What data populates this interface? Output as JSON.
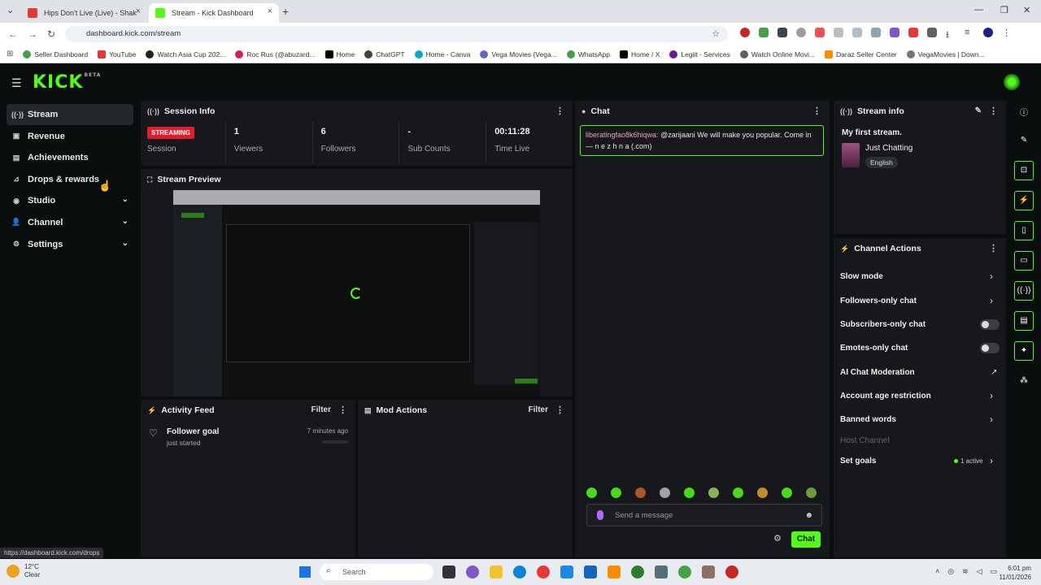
{
  "browser": {
    "tabs": [
      {
        "title": "Hips Don't Live (Live) - Shak",
        "active": false
      },
      {
        "title": "Stream - Kick Dashboard",
        "active": true
      }
    ],
    "url": "dashboard.kick.com/stream",
    "bookmarks": [
      "Seller Dashboard",
      "YouTube",
      "Watch Asia Cup 202...",
      "Roc Rus (@abuzard...",
      "Home",
      "ChatGPT",
      "Home - Canva",
      "Vega Movies (Vega...",
      "WhatsApp",
      "Home / X",
      "Legiit - Services",
      "Watch Online Movi...",
      "Daraz Seller Center",
      "VegaMovies | Down..."
    ],
    "status_url": "https://dashboard.kick.com/drops"
  },
  "app": {
    "logo": "KICK",
    "logo_tag": "BETA"
  },
  "sidebar": {
    "items": [
      {
        "label": "Stream",
        "icon": "broadcast-icon",
        "active": true,
        "chevron": false
      },
      {
        "label": "Revenue",
        "icon": "revenue-icon",
        "active": false,
        "chevron": false
      },
      {
        "label": "Achievements",
        "icon": "achievements-icon",
        "active": false,
        "chevron": false
      },
      {
        "label": "Drops & rewards",
        "icon": "drops-icon",
        "active": false,
        "chevron": false
      },
      {
        "label": "Studio",
        "icon": "studio-icon",
        "active": false,
        "chevron": true
      },
      {
        "label": "Channel",
        "icon": "channel-icon",
        "active": false,
        "chevron": true
      },
      {
        "label": "Settings",
        "icon": "settings-icon",
        "active": false,
        "chevron": true
      }
    ]
  },
  "session": {
    "title": "Session Info",
    "status_badge": "STREAMING",
    "status_label": "Session",
    "viewers_value": "1",
    "viewers_label": "Viewers",
    "followers_value": "6",
    "followers_label": "Followers",
    "subs_value": "-",
    "subs_label": "Sub Counts",
    "time_value": "00:11:28",
    "time_label": "Time Live"
  },
  "preview": {
    "title": "Stream Preview"
  },
  "activity": {
    "title": "Activity Feed",
    "filter": "Filter",
    "item_title": "Follower goal",
    "item_sub": "just started",
    "item_time": "7 minutes ago"
  },
  "mod": {
    "title": "Mod Actions",
    "filter": "Filter"
  },
  "chat": {
    "title": "Chat",
    "message_user": "liberatingfao8k6hiqwa:",
    "message_text": "@zarijaani We will make you popular. Come in — n e z h n a (.com)",
    "placeholder": "Send a message",
    "send_label": "Chat"
  },
  "stream_info": {
    "title": "Stream info",
    "stream_title": "My first stream.",
    "category": "Just Chatting",
    "language": "English"
  },
  "channel_actions": {
    "title": "Channel Actions",
    "items": [
      {
        "label": "Slow mode",
        "control": "chevron"
      },
      {
        "label": "Followers-only chat",
        "control": "chevron"
      },
      {
        "label": "Subscribers-only chat",
        "control": "toggle"
      },
      {
        "label": "Emotes-only chat",
        "control": "toggle"
      },
      {
        "label": "AI Chat Moderation",
        "control": "external"
      },
      {
        "label": "Account age restriction",
        "control": "chevron"
      },
      {
        "label": "Banned words",
        "control": "chevron"
      },
      {
        "label": "Host Channel",
        "control": "none"
      },
      {
        "label": "Set goals",
        "control": "chevron"
      }
    ],
    "goals_status": "1 active"
  },
  "taskbar": {
    "temp": "12°C",
    "weather": "Clear",
    "search": "Search",
    "time": "6:01 pm",
    "date": "11/01/2026"
  },
  "colors": {
    "brand": "#53fc18",
    "live": "#e01c2e"
  }
}
